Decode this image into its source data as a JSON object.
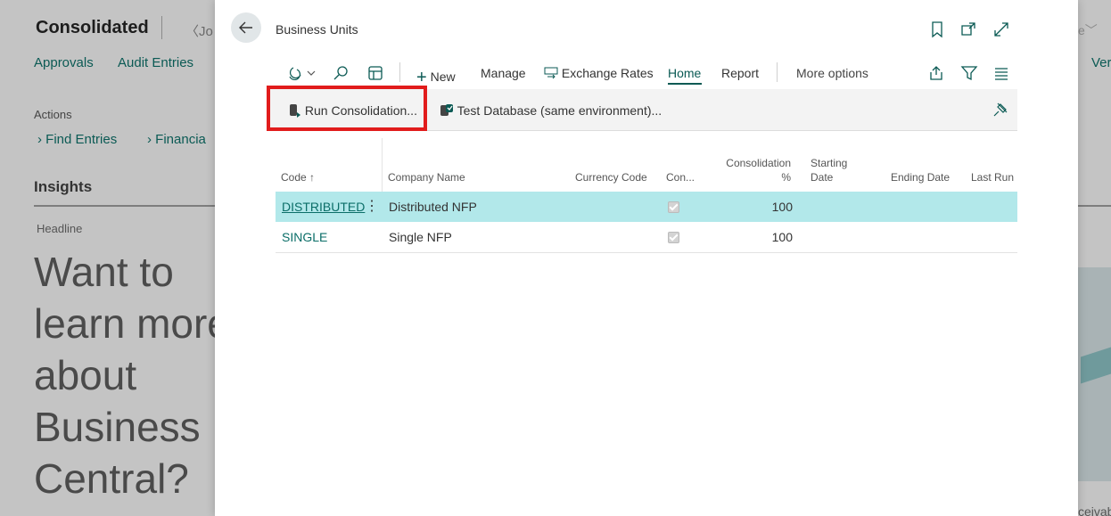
{
  "background": {
    "title": "Consolidated",
    "crumb": "Jo",
    "nav": [
      "Approvals",
      "Audit Entries"
    ],
    "right_nav": "Ver",
    "actions_label": "Actions",
    "links": [
      "Find Entries",
      "Financia"
    ],
    "insights": "Insights",
    "headline_label": "Headline",
    "headline_text": "Want to learn more about Business Central?",
    "bottom_text": "ceivab"
  },
  "modal": {
    "title": "Business Units",
    "commands": {
      "new": "New",
      "manage": "Manage",
      "exchange_rates": "Exchange Rates",
      "home": "Home",
      "report": "Report",
      "more_options": "More options"
    },
    "actions": {
      "run_consolidation": "Run Consolidation...",
      "test_database": "Test Database (same environment)..."
    },
    "table": {
      "headers": {
        "code": "Code ↑",
        "company_name": "Company Name",
        "currency_code": "Currency Code",
        "con": "Con...",
        "consolidation_pct_1": "Consolidation",
        "consolidation_pct_2": "%",
        "starting_date_1": "Starting",
        "starting_date_2": "Date",
        "ending_date": "Ending Date",
        "last_run": "Last Run"
      },
      "rows": [
        {
          "code": "DISTRIBUTED",
          "company_name": "Distributed NFP",
          "currency_code": "",
          "consolidate": true,
          "pct": "100"
        },
        {
          "code": "SINGLE",
          "company_name": "Single NFP",
          "currency_code": "",
          "consolidate": true,
          "pct": "100"
        }
      ]
    }
  },
  "colors": {
    "accent": "#0b5a54",
    "selected_row": "#b2e8ea",
    "highlight_box": "#e11c1c"
  }
}
